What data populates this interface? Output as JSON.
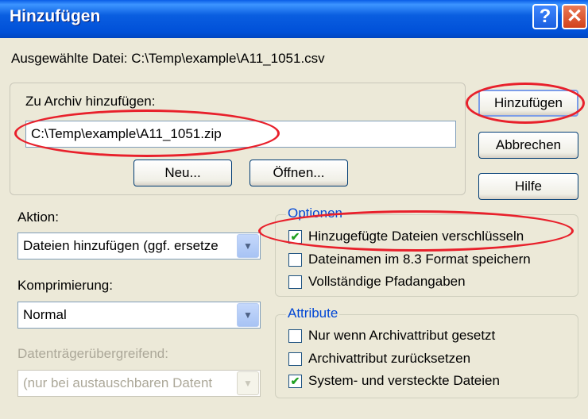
{
  "window": {
    "title": "Hinzufügen",
    "help_glyph": "?",
    "close_glyph": "✕"
  },
  "selected_file": "Ausgewählte Datei: C:\\Temp\\example\\A11_1051.csv",
  "archive": {
    "label": "Zu Archiv hinzufügen:",
    "path": "C:\\Temp\\example\\A11_1051.zip",
    "new_button": "Neu...",
    "open_button": "Öffnen..."
  },
  "buttons": {
    "add": "Hinzufügen",
    "cancel": "Abbrechen",
    "help": "Hilfe"
  },
  "action": {
    "label": "Aktion:",
    "value": "Dateien hinzufügen (ggf. ersetze"
  },
  "compression": {
    "label": "Komprimierung:",
    "value": "Normal"
  },
  "spanning": {
    "label": "Datenträgerübergreifend:",
    "value": "(nur bei austauschbaren Datent"
  },
  "options": {
    "legend": "Optionen",
    "items": [
      {
        "label": "Hinzugefügte Dateien verschlüsseln",
        "checked": true
      },
      {
        "label": "Dateinamen im 8.3 Format speichern",
        "checked": false
      },
      {
        "label": "Vollständige Pfadangaben",
        "checked": false
      }
    ]
  },
  "attributes": {
    "legend": "Attribute",
    "items": [
      {
        "label": "Nur wenn Archivattribut gesetzt",
        "checked": false
      },
      {
        "label": "Archivattribut zurücksetzen",
        "checked": false
      },
      {
        "label": "System- und versteckte Dateien",
        "checked": true
      }
    ]
  },
  "glyphs": {
    "check": "✔",
    "dropdown": "▼"
  },
  "colors": {
    "highlight_ring": "#e8202b",
    "titlebar": "#0a5ee0",
    "legend_text": "#0046d5"
  }
}
